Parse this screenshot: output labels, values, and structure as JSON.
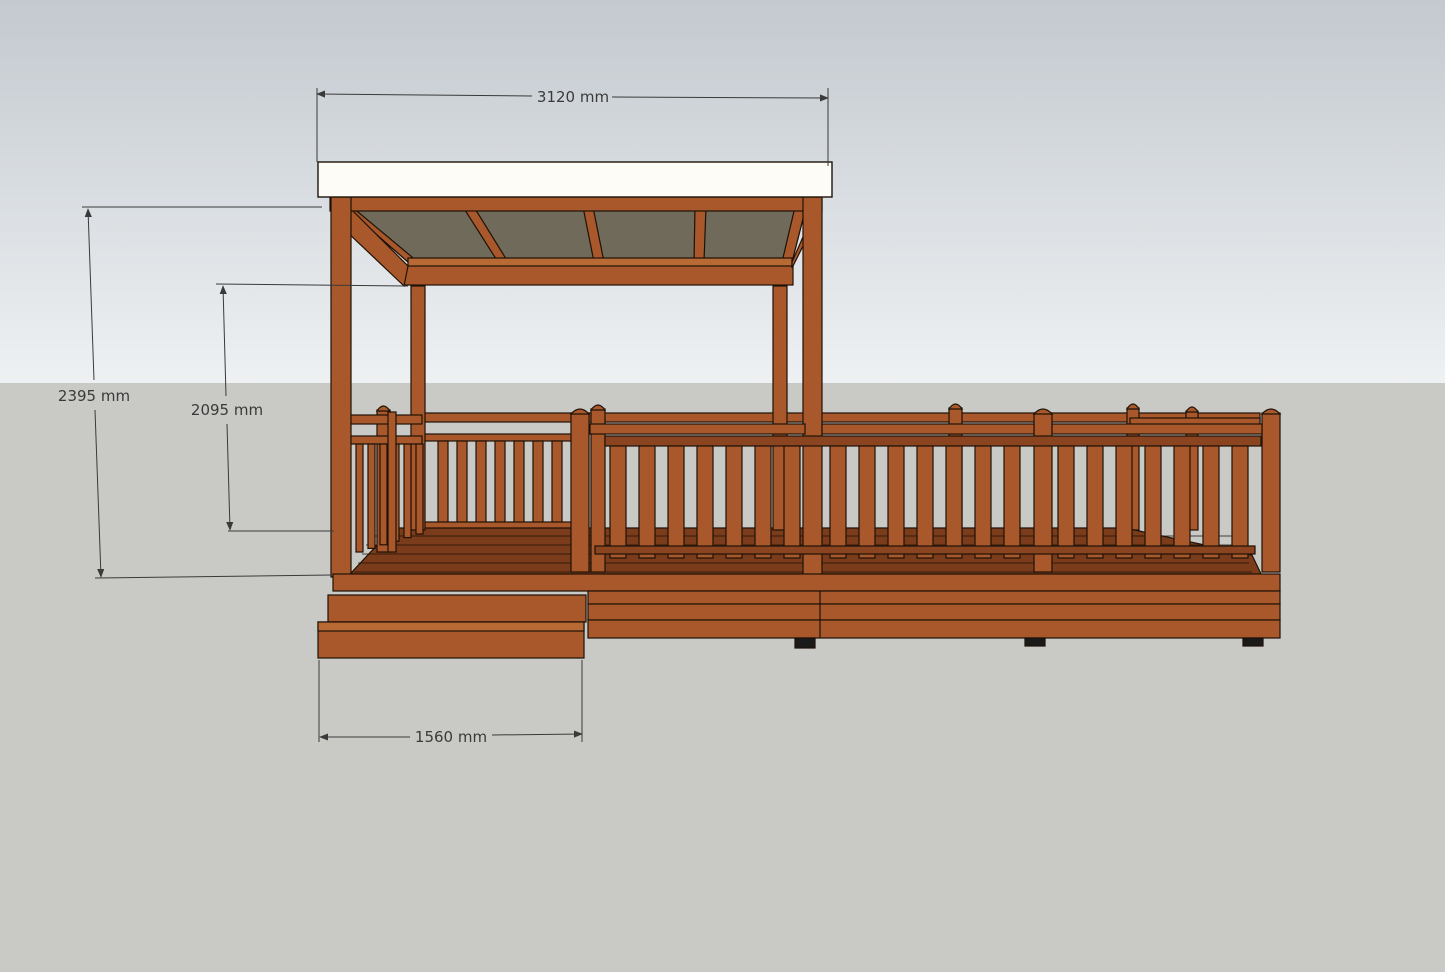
{
  "colors": {
    "sky_top": "#c3c9cf",
    "sky_bottom": "#eef1f3",
    "ground": "#c9c9c5",
    "wood": "#a8582a",
    "wood_dark": "#8a4520",
    "wood_light": "#b86a35",
    "floor": "#7a3c1a",
    "roof": "#fdfcf6",
    "canopy": "#6f6a5a",
    "outline": "#1e1208",
    "dimension_line": "#3a3a3a"
  },
  "dimensions": {
    "width_top": "3120 mm",
    "height_total": "2395 mm",
    "height_inner": "2095 mm",
    "step_width": "1560 mm"
  }
}
